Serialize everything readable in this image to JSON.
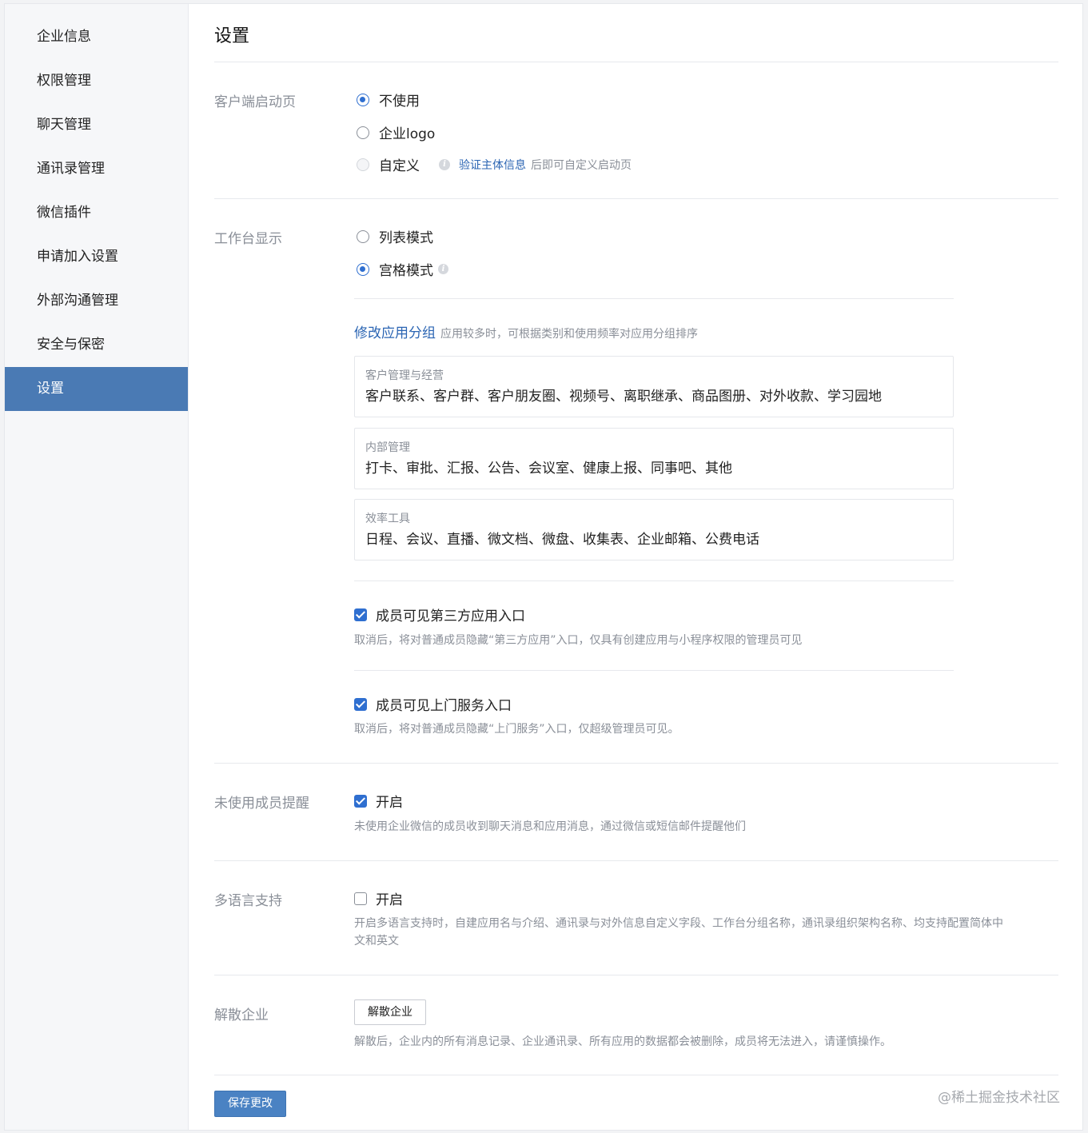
{
  "sidebar": {
    "items": [
      {
        "label": "企业信息"
      },
      {
        "label": "权限管理"
      },
      {
        "label": "聊天管理"
      },
      {
        "label": "通讯录管理"
      },
      {
        "label": "微信插件"
      },
      {
        "label": "申请加入设置"
      },
      {
        "label": "外部沟通管理"
      },
      {
        "label": "安全与保密"
      },
      {
        "label": "设置",
        "active": true
      }
    ]
  },
  "page": {
    "title": "设置"
  },
  "launch_page": {
    "label": "客户端启动页",
    "options": [
      {
        "label": "不使用",
        "checked": true
      },
      {
        "label": "企业logo",
        "checked": false
      },
      {
        "label": "自定义",
        "checked": false,
        "disabled": true
      }
    ],
    "hint_link": "验证主体信息",
    "hint_text": "后即可自定义启动页",
    "hint_icon": "info-icon"
  },
  "workbench": {
    "label": "工作台显示",
    "options": [
      {
        "label": "列表模式",
        "checked": false
      },
      {
        "label": "宫格模式",
        "checked": true
      }
    ],
    "modify_group_link": "修改应用分组",
    "modify_group_hint": "应用较多时，可根据类别和使用频率对应用分组排序",
    "groups": [
      {
        "title": "客户管理与经营",
        "items": "客户联系、客户群、客户朋友圈、视频号、离职继承、商品图册、对外收款、学习园地"
      },
      {
        "title": "内部管理",
        "items": "打卡、审批、汇报、公告、会议室、健康上报、同事吧、其他"
      },
      {
        "title": "效率工具",
        "items": "日程、会议、直播、微文档、微盘、收集表、企业邮箱、公费电话"
      }
    ],
    "third_party": {
      "label": "成员可见第三方应用入口",
      "checked": true,
      "desc": "取消后，将对普通成员隐藏“第三方应用”入口，仅具有创建应用与小程序权限的管理员可见"
    },
    "door_service": {
      "label": "成员可见上门服务入口",
      "checked": true,
      "desc": "取消后，将对普通成员隐藏“上门服务”入口，仅超级管理员可见。"
    }
  },
  "unused_reminder": {
    "label": "未使用成员提醒",
    "option": "开启",
    "checked": true,
    "desc": "未使用企业微信的成员收到聊天消息和应用消息，通过微信或短信邮件提醒他们"
  },
  "multilang": {
    "label": "多语言支持",
    "option": "开启",
    "checked": false,
    "desc_line1": "开启多语言支持时，自建应用名与介绍、通讯录与对外信息自定义字段、工作台分组名称，通讯录组织架构名称、均支持配置简体中",
    "desc_line2": "文和英文"
  },
  "dissolve": {
    "label": "解散企业",
    "button": "解散企业",
    "desc": "解散后，企业内的所有消息记录、企业通讯录、所有应用的数据都会被删除，成员将无法进入，请谨慎操作。"
  },
  "footer": {
    "save_button": "保存更改",
    "watermark": "@稀土掘金技术社区"
  },
  "colors": {
    "accent": "#2f6fd0",
    "sidebar_active": "#4a7ab4",
    "primary_button": "#4a82c3",
    "link": "#2b65b3"
  }
}
